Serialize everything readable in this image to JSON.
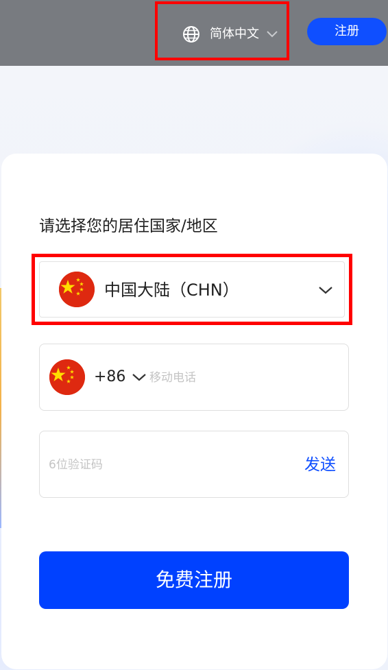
{
  "header": {
    "language": {
      "label": "简体中文",
      "icon": "globe-icon",
      "caret_icon": "chevron-down-icon"
    },
    "register_label": "注册"
  },
  "form": {
    "country_prompt": "请选择您的居住国家/地区",
    "country": {
      "flag_icon": "china-flag-icon",
      "name": "中国大陆（CHN）",
      "caret_icon": "chevron-down-icon"
    },
    "phone": {
      "flag_icon": "china-flag-icon",
      "dial_code": "+86",
      "placeholder": "移动电话",
      "value": ""
    },
    "code": {
      "placeholder": "6位验证码",
      "value": "",
      "send_label": "发送"
    },
    "submit_label": "免费注册"
  },
  "colors": {
    "header_bg": "#787b80",
    "accent": "#0041ff",
    "highlight": "#ff0000",
    "flag_red": "#de2910",
    "flag_yellow": "#ffde00"
  }
}
